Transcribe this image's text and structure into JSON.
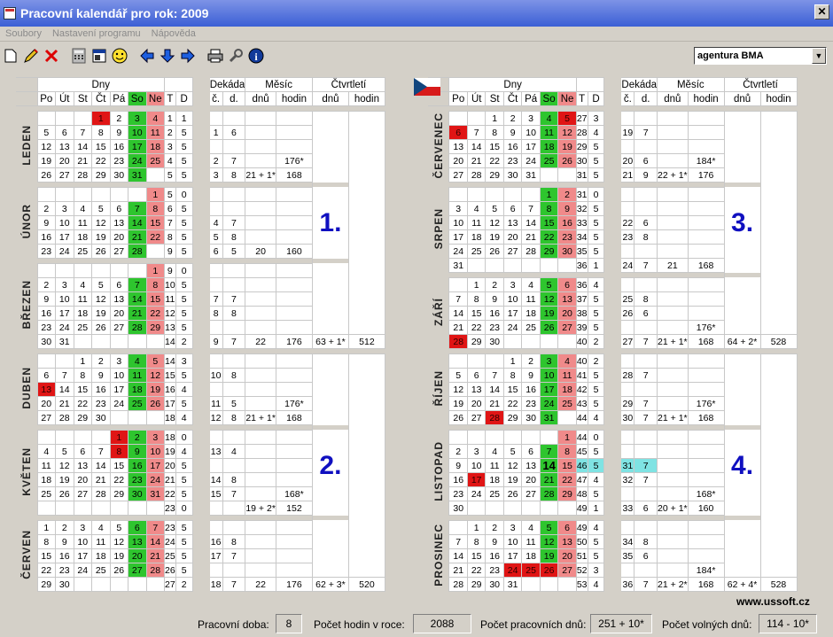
{
  "window": {
    "title": "Pracovní kalendář pro rok: 2009",
    "agency": "agentura BMA",
    "url": "www.ussoft.cz"
  },
  "menu": [
    {
      "label": "Soubory"
    },
    {
      "label": "Nastavení programu"
    },
    {
      "label": "Nápověda"
    }
  ],
  "headers": {
    "dny": "Dny",
    "dekada": "Dekáda",
    "mesic": "Měsíc",
    "ctvrtleti": "Čtvrtletí",
    "days": [
      "Po",
      "Út",
      "St",
      "Čt",
      "Pá",
      "So",
      "Ne"
    ],
    "t": "T",
    "d": "D",
    "c": "č.",
    "dd": "d.",
    "dnu": "dnů",
    "hodin": "hodin"
  },
  "colors": {
    "saturday": "#2ec52e",
    "sunday": "#f08a8a",
    "holiday": "#e01515",
    "highlight": "#7fe3e3",
    "quarter_text": "#1010c0"
  },
  "quarters": [
    {
      "label": "1.",
      "dnu": "63 + 1*",
      "hodin": "512"
    },
    {
      "label": "2.",
      "dnu": "62 + 3*",
      "hodin": "520"
    },
    {
      "label": "3.",
      "dnu": "64 + 2*",
      "hodin": "528"
    },
    {
      "label": "4.",
      "dnu": "62 + 4*",
      "hodin": "528"
    }
  ],
  "months": [
    {
      "name": "LEDEN",
      "dnu": "21 + 1*",
      "hodin": "168",
      "hodin_star": "176*",
      "hol": [
        1
      ],
      "weeks": [
        {
          "days": [
            "",
            "",
            "",
            "1",
            "2",
            "3",
            "4"
          ],
          "t": "1",
          "d": "1"
        },
        {
          "days": [
            "5",
            "6",
            "7",
            "8",
            "9",
            "10",
            "11"
          ],
          "t": "2",
          "d": "5",
          "c": "1",
          "dd": "6"
        },
        {
          "days": [
            "12",
            "13",
            "14",
            "15",
            "16",
            "17",
            "18"
          ],
          "t": "3",
          "d": "5"
        },
        {
          "days": [
            "19",
            "20",
            "21",
            "22",
            "23",
            "24",
            "25"
          ],
          "t": "4",
          "d": "5",
          "c": "2",
          "dd": "7"
        },
        {
          "days": [
            "26",
            "27",
            "28",
            "29",
            "30",
            "31",
            ""
          ],
          "t": "5",
          "d": "5",
          "c": "3",
          "dd": "8"
        }
      ]
    },
    {
      "name": "ÚNOR",
      "dnu": "20",
      "hodin": "160",
      "weeks": [
        {
          "days": [
            "",
            "",
            "",
            "",
            "",
            "",
            "1"
          ],
          "t": "5",
          "d": "0"
        },
        {
          "days": [
            "2",
            "3",
            "4",
            "5",
            "6",
            "7",
            "8"
          ],
          "t": "6",
          "d": "5"
        },
        {
          "days": [
            "9",
            "10",
            "11",
            "12",
            "13",
            "14",
            "15"
          ],
          "t": "7",
          "d": "5",
          "c": "4",
          "dd": "7"
        },
        {
          "days": [
            "16",
            "17",
            "18",
            "19",
            "20",
            "21",
            "22"
          ],
          "t": "8",
          "d": "5",
          "c": "5",
          "dd": "8"
        },
        {
          "days": [
            "23",
            "24",
            "25",
            "26",
            "27",
            "28",
            ""
          ],
          "t": "9",
          "d": "5",
          "c": "6",
          "dd": "5"
        }
      ]
    },
    {
      "name": "BŘEZEN",
      "dnu": "22",
      "hodin": "176",
      "weeks": [
        {
          "days": [
            "",
            "",
            "",
            "",
            "",
            "",
            "1"
          ],
          "t": "9",
          "d": "0"
        },
        {
          "days": [
            "2",
            "3",
            "4",
            "5",
            "6",
            "7",
            "8"
          ],
          "t": "10",
          "d": "5"
        },
        {
          "days": [
            "9",
            "10",
            "11",
            "12",
            "13",
            "14",
            "15"
          ],
          "t": "11",
          "d": "5",
          "c": "7",
          "dd": "7"
        },
        {
          "days": [
            "16",
            "17",
            "18",
            "19",
            "20",
            "21",
            "22"
          ],
          "t": "12",
          "d": "5",
          "c": "8",
          "dd": "8"
        },
        {
          "days": [
            "23",
            "24",
            "25",
            "26",
            "27",
            "28",
            "29"
          ],
          "t": "13",
          "d": "5"
        },
        {
          "days": [
            "30",
            "31",
            "",
            "",
            "",
            "",
            ""
          ],
          "t": "14",
          "d": "2",
          "c": "9",
          "dd": "7"
        }
      ]
    },
    {
      "name": "DUBEN",
      "dnu": "21 + 1*",
      "hodin": "168",
      "hodin_star": "176*",
      "hol": [
        13
      ],
      "weeks": [
        {
          "days": [
            "",
            "",
            "1",
            "2",
            "3",
            "4",
            "5"
          ],
          "t": "14",
          "d": "3"
        },
        {
          "days": [
            "6",
            "7",
            "8",
            "9",
            "10",
            "11",
            "12"
          ],
          "t": "15",
          "d": "5",
          "c": "10",
          "dd": "8"
        },
        {
          "days": [
            "13",
            "14",
            "15",
            "16",
            "17",
            "18",
            "19"
          ],
          "t": "16",
          "d": "4"
        },
        {
          "days": [
            "20",
            "21",
            "22",
            "23",
            "24",
            "25",
            "26"
          ],
          "t": "17",
          "d": "5",
          "c": "11",
          "dd": "5"
        },
        {
          "days": [
            "27",
            "28",
            "29",
            "30",
            "",
            "",
            ""
          ],
          "t": "18",
          "d": "4",
          "c": "12",
          "dd": "8"
        }
      ]
    },
    {
      "name": "KVĚTEN",
      "dnu": "19 + 2*",
      "hodin": "152",
      "hodin_star": "168*",
      "hol": [
        1,
        8
      ],
      "weeks": [
        {
          "days": [
            "",
            "",
            "",
            "",
            "1",
            "2",
            "3"
          ],
          "t": "18",
          "d": "0"
        },
        {
          "days": [
            "4",
            "5",
            "6",
            "7",
            "8",
            "9",
            "10"
          ],
          "t": "19",
          "d": "4",
          "c": "13",
          "dd": "4"
        },
        {
          "days": [
            "11",
            "12",
            "13",
            "14",
            "15",
            "16",
            "17"
          ],
          "t": "20",
          "d": "5"
        },
        {
          "days": [
            "18",
            "19",
            "20",
            "21",
            "22",
            "23",
            "24"
          ],
          "t": "21",
          "d": "5",
          "c": "14",
          "dd": "8"
        },
        {
          "days": [
            "25",
            "26",
            "27",
            "28",
            "29",
            "30",
            "31"
          ],
          "t": "22",
          "d": "5",
          "c": "15",
          "dd": "7"
        },
        {
          "days": [
            "",
            "",
            "",
            "",
            "",
            "",
            ""
          ],
          "t": "23",
          "d": "0"
        }
      ]
    },
    {
      "name": "ČERVEN",
      "dnu": "22",
      "hodin": "176",
      "weeks": [
        {
          "days": [
            "1",
            "2",
            "3",
            "4",
            "5",
            "6",
            "7"
          ],
          "t": "23",
          "d": "5"
        },
        {
          "days": [
            "8",
            "9",
            "10",
            "11",
            "12",
            "13",
            "14"
          ],
          "t": "24",
          "d": "5",
          "c": "16",
          "dd": "8"
        },
        {
          "days": [
            "15",
            "16",
            "17",
            "18",
            "19",
            "20",
            "21"
          ],
          "t": "25",
          "d": "5",
          "c": "17",
          "dd": "7"
        },
        {
          "days": [
            "22",
            "23",
            "24",
            "25",
            "26",
            "27",
            "28"
          ],
          "t": "26",
          "d": "5"
        },
        {
          "days": [
            "29",
            "30",
            "",
            "",
            "",
            "",
            ""
          ],
          "t": "27",
          "d": "2",
          "c": "18",
          "dd": "7"
        }
      ]
    },
    {
      "name": "ČERVENEC",
      "dnu": "22 + 1*",
      "hodin": "176",
      "hodin_star": "184*",
      "hol": [
        5,
        6
      ],
      "weeks": [
        {
          "days": [
            "",
            "",
            "1",
            "2",
            "3",
            "4",
            "5"
          ],
          "t": "27",
          "d": "3"
        },
        {
          "days": [
            "6",
            "7",
            "8",
            "9",
            "10",
            "11",
            "12"
          ],
          "t": "28",
          "d": "4",
          "c": "19",
          "dd": "7"
        },
        {
          "days": [
            "13",
            "14",
            "15",
            "16",
            "17",
            "18",
            "19"
          ],
          "t": "29",
          "d": "5"
        },
        {
          "days": [
            "20",
            "21",
            "22",
            "23",
            "24",
            "25",
            "26"
          ],
          "t": "30",
          "d": "5",
          "c": "20",
          "dd": "6"
        },
        {
          "days": [
            "27",
            "28",
            "29",
            "30",
            "31",
            "",
            ""
          ],
          "t": "31",
          "d": "5",
          "c": "21",
          "dd": "9"
        }
      ]
    },
    {
      "name": "SRPEN",
      "dnu": "21",
      "hodin": "168",
      "weeks": [
        {
          "days": [
            "",
            "",
            "",
            "",
            "",
            "1",
            "2"
          ],
          "t": "31",
          "d": "0"
        },
        {
          "days": [
            "3",
            "4",
            "5",
            "6",
            "7",
            "8",
            "9"
          ],
          "t": "32",
          "d": "5"
        },
        {
          "days": [
            "10",
            "11",
            "12",
            "13",
            "14",
            "15",
            "16"
          ],
          "t": "33",
          "d": "5",
          "c": "22",
          "dd": "6"
        },
        {
          "days": [
            "17",
            "18",
            "19",
            "20",
            "21",
            "22",
            "23"
          ],
          "t": "34",
          "d": "5",
          "c": "23",
          "dd": "8"
        },
        {
          "days": [
            "24",
            "25",
            "26",
            "27",
            "28",
            "29",
            "30"
          ],
          "t": "35",
          "d": "5"
        },
        {
          "days": [
            "31",
            "",
            "",
            "",
            "",
            "",
            ""
          ],
          "t": "36",
          "d": "1",
          "c": "24",
          "dd": "7"
        }
      ]
    },
    {
      "name": "ZÁŘÍ",
      "dnu": "21 + 1*",
      "hodin": "168",
      "hodin_star": "176*",
      "hol": [
        28
      ],
      "weeks": [
        {
          "days": [
            "",
            "1",
            "2",
            "3",
            "4",
            "5",
            "6"
          ],
          "t": "36",
          "d": "4"
        },
        {
          "days": [
            "7",
            "8",
            "9",
            "10",
            "11",
            "12",
            "13"
          ],
          "t": "37",
          "d": "5",
          "c": "25",
          "dd": "8"
        },
        {
          "days": [
            "14",
            "15",
            "16",
            "17",
            "18",
            "19",
            "20"
          ],
          "t": "38",
          "d": "5",
          "c": "26",
          "dd": "6"
        },
        {
          "days": [
            "21",
            "22",
            "23",
            "24",
            "25",
            "26",
            "27"
          ],
          "t": "39",
          "d": "5"
        },
        {
          "days": [
            "28",
            "29",
            "30",
            "",
            "",
            "",
            ""
          ],
          "t": "40",
          "d": "2",
          "c": "27",
          "dd": "7"
        }
      ]
    },
    {
      "name": "ŘÍJEN",
      "dnu": "21 + 1*",
      "hodin": "168",
      "hodin_star": "176*",
      "hol": [
        28
      ],
      "weeks": [
        {
          "days": [
            "",
            "",
            "",
            "1",
            "2",
            "3",
            "4"
          ],
          "t": "40",
          "d": "2"
        },
        {
          "days": [
            "5",
            "6",
            "7",
            "8",
            "9",
            "10",
            "11"
          ],
          "t": "41",
          "d": "5",
          "c": "28",
          "dd": "7"
        },
        {
          "days": [
            "12",
            "13",
            "14",
            "15",
            "16",
            "17",
            "18"
          ],
          "t": "42",
          "d": "5"
        },
        {
          "days": [
            "19",
            "20",
            "21",
            "22",
            "23",
            "24",
            "25"
          ],
          "t": "43",
          "d": "5",
          "c": "29",
          "dd": "7"
        },
        {
          "days": [
            "26",
            "27",
            "28",
            "29",
            "30",
            "31",
            ""
          ],
          "t": "44",
          "d": "4",
          "c": "30",
          "dd": "7"
        }
      ]
    },
    {
      "name": "LISTOPAD",
      "dnu": "20 + 1*",
      "hodin": "160",
      "hodin_star": "168*",
      "hol": [
        17
      ],
      "today": 14,
      "hlweek": 2,
      "weeks": [
        {
          "days": [
            "",
            "",
            "",
            "",
            "",
            "",
            "1"
          ],
          "t": "44",
          "d": "0"
        },
        {
          "days": [
            "2",
            "3",
            "4",
            "5",
            "6",
            "7",
            "8"
          ],
          "t": "45",
          "d": "5"
        },
        {
          "days": [
            "9",
            "10",
            "11",
            "12",
            "13",
            "14",
            "15"
          ],
          "t": "46",
          "d": "5",
          "c": "31",
          "dd": "7"
        },
        {
          "days": [
            "16",
            "17",
            "18",
            "19",
            "20",
            "21",
            "22"
          ],
          "t": "47",
          "d": "4",
          "c": "32",
          "dd": "7"
        },
        {
          "days": [
            "23",
            "24",
            "25",
            "26",
            "27",
            "28",
            "29"
          ],
          "t": "48",
          "d": "5"
        },
        {
          "days": [
            "30",
            "",
            "",
            "",
            "",
            "",
            ""
          ],
          "t": "49",
          "d": "1",
          "c": "33",
          "dd": "6"
        }
      ]
    },
    {
      "name": "PROSINEC",
      "dnu": "21 + 2*",
      "hodin": "168",
      "hodin_star": "184*",
      "hol": [
        24,
        25,
        26
      ],
      "weeks": [
        {
          "days": [
            "",
            "1",
            "2",
            "3",
            "4",
            "5",
            "6"
          ],
          "t": "49",
          "d": "4"
        },
        {
          "days": [
            "7",
            "8",
            "9",
            "10",
            "11",
            "12",
            "13"
          ],
          "t": "50",
          "d": "5",
          "c": "34",
          "dd": "8"
        },
        {
          "days": [
            "14",
            "15",
            "16",
            "17",
            "18",
            "19",
            "20"
          ],
          "t": "51",
          "d": "5",
          "c": "35",
          "dd": "6"
        },
        {
          "days": [
            "21",
            "22",
            "23",
            "24",
            "25",
            "26",
            "27"
          ],
          "t": "52",
          "d": "3"
        },
        {
          "days": [
            "28",
            "29",
            "30",
            "31",
            "",
            "",
            ""
          ],
          "t": "53",
          "d": "4",
          "c": "36",
          "dd": "7"
        }
      ]
    }
  ],
  "status": {
    "pracovni_doba_label": "Pracovní doba:",
    "pracovni_doba": "8",
    "hodin_label": "Počet hodin v roce:",
    "hodin": "2088",
    "prac_dnu_label": "Počet pracovních dnů:",
    "prac_dnu": "251 + 10*",
    "volnych_label": "Počet volných dnů:",
    "volnych": "114 - 10*"
  }
}
